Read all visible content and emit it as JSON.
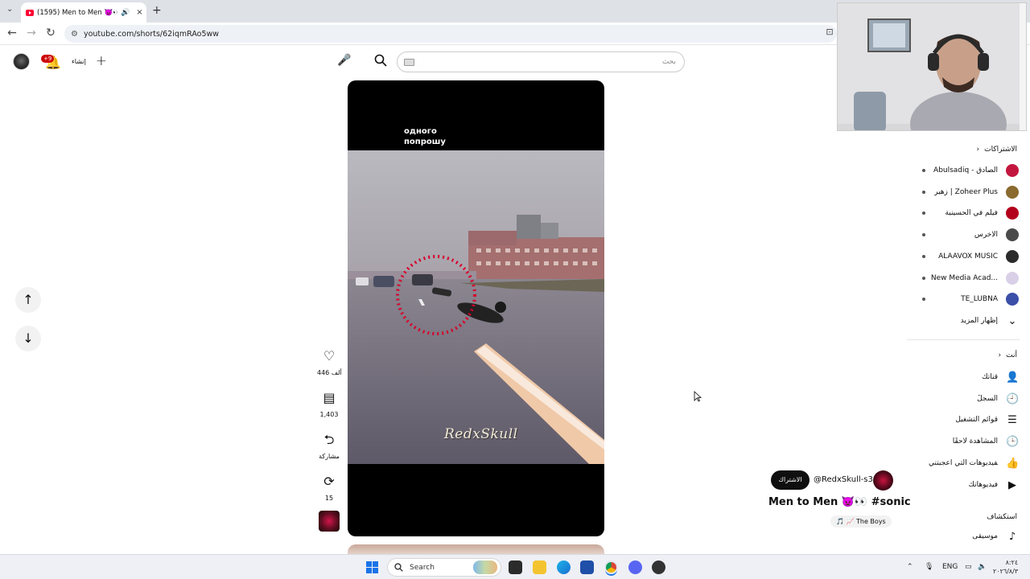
{
  "browser": {
    "tab_title": "(1595) Men to Men 👿👀 #",
    "tab_close": "×",
    "new_tab": "+",
    "url": "youtube.com/shorts/62iqmRAo5ww",
    "back": "←",
    "forward": "→",
    "reload": "↻"
  },
  "header": {
    "notification_count": "+9",
    "create_label": "إنشاء",
    "create_icon": "+",
    "search_placeholder": "بحث"
  },
  "video": {
    "caption_line1": "одного",
    "caption_line2": "попрошу",
    "watermark": "RedxSkull"
  },
  "actions": {
    "like_count": "446 ألف",
    "comment_count": "1,403",
    "share_label": "مشاركة",
    "remix_count": "15"
  },
  "meta": {
    "subscribe_label": "الاشتراك",
    "handle": "@RedxSkull-s3w",
    "title": "Men to Men 👿👀 #sonic",
    "sound": "🎵 📈 The Boys"
  },
  "sidebar": {
    "subscriptions_title": "الاشتراكات",
    "subscriptions": [
      {
        "label": "Abulsadiq - الصادق",
        "color": "#c3163f"
      },
      {
        "label": "زهير | Zoheer Plus",
        "color": "#8a6a2e"
      },
      {
        "label": "فيلم في الحسينية",
        "color": "#b3001b"
      },
      {
        "label": "الاخرس",
        "color": "#4a4a4a"
      },
      {
        "label": "ALAAVOX MUSIC",
        "color": "#2b2b2b"
      },
      {
        "label": "New Media Acad...",
        "color": "#d9d0e8"
      },
      {
        "label": "TE_LUBNA",
        "color": "#3b4ea8"
      }
    ],
    "show_more": "إظهار المزيد",
    "you_title": "أنت",
    "you_items": [
      {
        "label": "قناتك",
        "icon": "person-icon",
        "glyph": "👤"
      },
      {
        "label": "السجلّ",
        "icon": "history-icon",
        "glyph": "🕘"
      },
      {
        "label": "قوائم التشغيل",
        "icon": "playlists-icon",
        "glyph": "☰"
      },
      {
        "label": "المشاهدة لاحقًا",
        "icon": "watch-later-icon",
        "glyph": "🕒"
      },
      {
        "label": "الفيديوهات التي أعجبتني",
        "icon": "thumbs-up-icon",
        "glyph": "👍"
      },
      {
        "label": "فيديوهاتك",
        "icon": "your-videos-icon",
        "glyph": "▶"
      }
    ],
    "explore_title": "استكشاف",
    "explore_items": [
      {
        "label": "موسيقى",
        "icon": "music-icon",
        "glyph": "♪"
      }
    ]
  },
  "taskbar": {
    "search_label": "Search",
    "language": "ENG",
    "time": "٨:٢٤",
    "date": "٢٠٢٦/٨/٣"
  },
  "colors": {
    "accent": "#ff0033",
    "tabstrip": "#dee1e6",
    "taskbar": "#eef0f5"
  }
}
